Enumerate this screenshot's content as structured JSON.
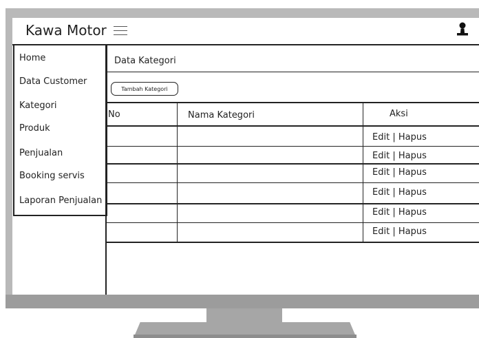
{
  "app": {
    "title": "Kawa Motor"
  },
  "sidebar": {
    "items": [
      {
        "label": "Home"
      },
      {
        "label": "Data Customer"
      },
      {
        "label": "Kategori"
      },
      {
        "label": "Produk"
      },
      {
        "label": "Penjualan"
      },
      {
        "label": "Booking servis"
      },
      {
        "label": "Laporan Penjualan"
      }
    ]
  },
  "main": {
    "title": "Data Kategori",
    "add_button_label": "Tambah Kategori",
    "table": {
      "columns": [
        "No",
        "Nama Kategori",
        "Aksi"
      ],
      "rows": [
        {
          "no": "",
          "name": "",
          "edit": "Edit",
          "sep": "|",
          "delete": "Hapus"
        },
        {
          "no": "",
          "name": "",
          "edit": "Edit",
          "sep": "|",
          "delete": "Hapus"
        },
        {
          "no": "",
          "name": "",
          "edit": "Edit",
          "sep": "|",
          "delete": "Hapus"
        },
        {
          "no": "",
          "name": "",
          "edit": "Edit",
          "sep": "|",
          "delete": "Hapus"
        },
        {
          "no": "",
          "name": "",
          "edit": "Edit",
          "sep": "|",
          "delete": "Hapus"
        },
        {
          "no": "",
          "name": "",
          "edit": "Edit",
          "sep": "|",
          "delete": "Hapus"
        }
      ]
    }
  },
  "icons": {
    "menu": "hamburger-menu-icon",
    "user": "user-icon"
  },
  "colors": {
    "bezel": "#b9b9b9",
    "line": "#222222",
    "screen": "#ffffff"
  }
}
